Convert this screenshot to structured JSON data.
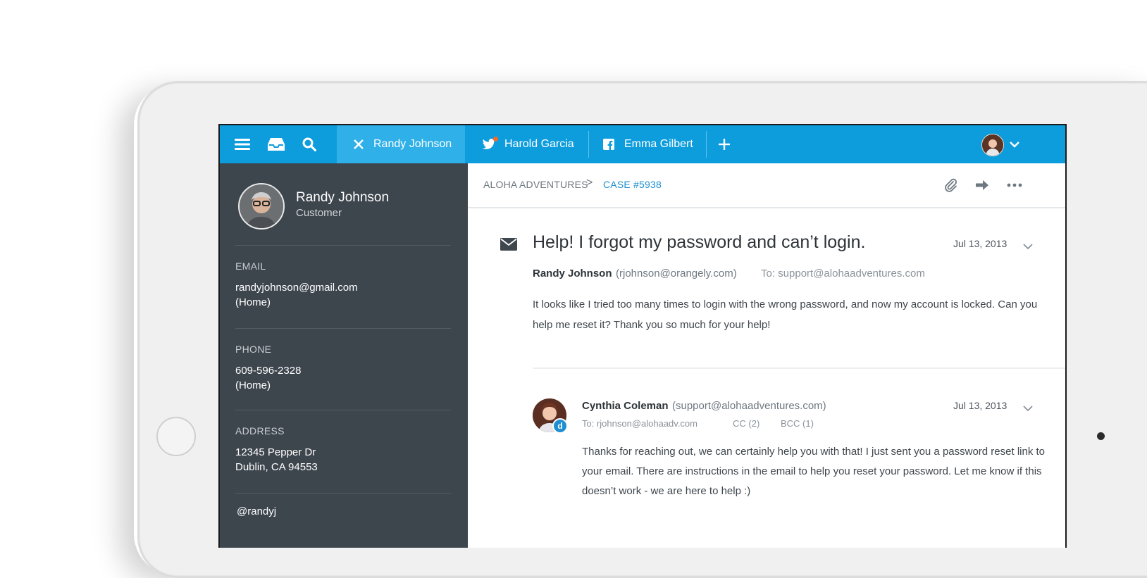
{
  "topbar": {
    "tabs": [
      {
        "label": "Randy Johnson",
        "icon": "close-icon",
        "active": true
      },
      {
        "label": "Harold Garcia",
        "icon": "twitter-icon",
        "active": false
      },
      {
        "label": "Emma Gilbert",
        "icon": "facebook-icon",
        "active": false
      }
    ]
  },
  "customer": {
    "name": "Randy Johnson",
    "role": "Customer",
    "email_label": "EMAIL",
    "email": "randyjohnson@gmail.com",
    "email_type": "(Home)",
    "phone_label": "PHONE",
    "phone": "609-596-2328",
    "phone_type": "(Home)",
    "address_label": "ADDRESS",
    "address_line1": "12345 Pepper Dr",
    "address_line2": "Dublin, CA 94553",
    "handle": "@randyj"
  },
  "breadcrumb": {
    "company": "ALOHA ADVENTURES",
    "separator": ">",
    "case": "CASE #5938"
  },
  "message": {
    "subject": "Help! I forgot my password and can’t login.",
    "date": "Jul 13, 2013",
    "from_name": "Randy Johnson",
    "from_email": "(rjohnson@orangely.com)",
    "to": "To: support@alohaadventures.com",
    "body": "It looks like I tried too many times to login with the wrong password, and now my account is locked. Can you help me reset it? Thank you so much for your help!"
  },
  "reply": {
    "name": "Cynthia Coleman",
    "email": "(support@alohaadventures.com)",
    "date": "Jul 13, 2013",
    "to": "To: rjohnson@alohaadv.com",
    "cc": "CC (2)",
    "bcc": "BCC (1)",
    "badge": "d",
    "body": "Thanks for reaching out, we can certainly help you with that! I just sent you a password reset link to your email. There are instructions in the email to help you reset your password. Let me know if this doesn’t work - we are here to help :)"
  },
  "colors": {
    "topbar": "#0d9ddd",
    "active_tab": "#2fb0e8",
    "sidebar": "#3d454d",
    "link": "#1f8fd0",
    "notification_dot": "#f26b2a"
  }
}
